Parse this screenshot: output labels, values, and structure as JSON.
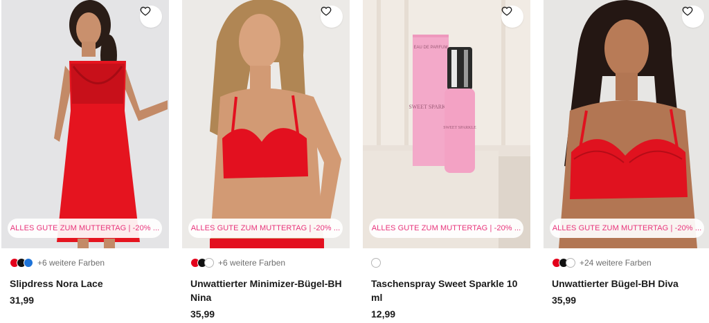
{
  "products": [
    {
      "promo": "ALLES GUTE ZUM MUTTERTAG | -20% ...",
      "swatches": [
        "#e3001b",
        "#111111",
        "#1e73d8"
      ],
      "more_colors": "+6 weitere Farben",
      "title": "Slipdress Nora Lace",
      "price": "31,99",
      "favorite_icon": "heart-outline-icon"
    },
    {
      "promo": "ALLES GUTE ZUM MUTTERTAG | -20% ...",
      "swatches": [
        "#e3001b",
        "#111111",
        "#ffffff"
      ],
      "more_colors": "+6 weitere Farben",
      "title": "Unwattierter Minimizer-Bügel-BH Nina",
      "price": "35,99",
      "favorite_icon": "heart-outline-icon"
    },
    {
      "promo": "ALLES GUTE ZUM MUTTERTAG | -20% ...",
      "swatches": [
        "#ffffff"
      ],
      "more_colors": "",
      "title": "Taschenspray Sweet Sparkle 10 ml",
      "price": "12,99",
      "favorite_icon": "heart-outline-icon",
      "box_label_top": "EAU DE PARFUM",
      "box_label_name": "SWEET SPARKLE",
      "bottle_label": "SWEET SPARKLE"
    },
    {
      "promo": "ALLES GUTE ZUM MUTTERTAG | -20% ...",
      "swatches": [
        "#e3001b",
        "#111111",
        "#ffffff"
      ],
      "more_colors": "+24 weitere Farben",
      "title": "Unwattierter Bügel-BH Diva",
      "price": "35,99",
      "favorite_icon": "heart-outline-icon"
    }
  ],
  "colors": {
    "promo_text": "#e8337a",
    "product_red": "#e3001b",
    "perfume_pink": "#f3a9c9"
  }
}
